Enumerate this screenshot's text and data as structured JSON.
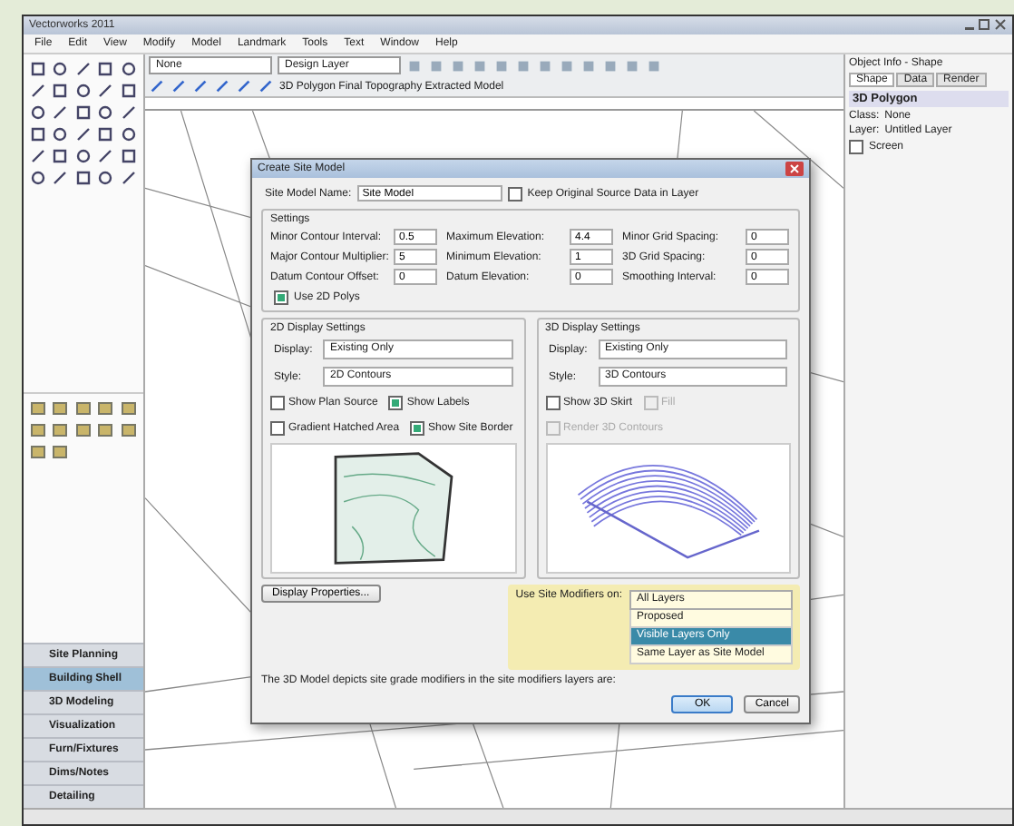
{
  "window": {
    "title": "Vectorworks 2011"
  },
  "menu": [
    "File",
    "Edit",
    "View",
    "Modify",
    "Model",
    "Landmark",
    "Tools",
    "Text",
    "Window",
    "Help"
  ],
  "view_bar": {
    "class": "None",
    "layer": "Design Layer",
    "view_label": "3D Polygon Final Topography Extracted Model"
  },
  "tool_sets": [
    {
      "label": "Site Planning",
      "selected": false
    },
    {
      "label": "Building Shell",
      "selected": true
    },
    {
      "label": "3D Modeling",
      "selected": false
    },
    {
      "label": "Visualization",
      "selected": false
    },
    {
      "label": "Furn/Fixtures",
      "selected": false
    },
    {
      "label": "Dims/Notes",
      "selected": false
    },
    {
      "label": "Detailing",
      "selected": false
    }
  ],
  "object_info": {
    "title": "Object Info - Shape",
    "tabs": [
      {
        "label": "Shape",
        "selected": true
      },
      {
        "label": "Data",
        "selected": false
      },
      {
        "label": "Render",
        "selected": false
      }
    ],
    "object": "3D Polygon",
    "fields": [
      {
        "label": "Class:",
        "value": "None"
      },
      {
        "label": "Layer:",
        "value": "Untitled Layer"
      }
    ],
    "screen": {
      "label": "Screen",
      "checked": false
    }
  },
  "dialog": {
    "title": "Create Site Model",
    "name_label": "Site Model Name:",
    "name_value": "Site Model",
    "keep_source": {
      "label": "Keep Original Source Data in Layer",
      "checked": false
    },
    "settings_title": "Settings",
    "settings": [
      {
        "label": "Minor Contour Interval:",
        "value": "0.5"
      },
      {
        "label": "Maximum Elevation:",
        "value": "4.4"
      },
      {
        "label": "Minor Grid Spacing:",
        "value": "0"
      },
      {
        "label": "Major Contour Multiplier:",
        "value": "5"
      },
      {
        "label": "Minimum Elevation:",
        "value": "1"
      },
      {
        "label": "3D Grid Spacing:",
        "value": "0"
      },
      {
        "label": "Datum Contour Offset:",
        "value": "0"
      },
      {
        "label": "Datum Elevation:",
        "value": "0"
      },
      {
        "label": "Smoothing Interval:",
        "value": "0"
      }
    ],
    "use_polys": {
      "label": "Use 2D Polys",
      "checked": true
    },
    "panels": [
      {
        "title": "2D Display Settings",
        "display_label": "Display:",
        "display": "Existing Only",
        "style_label": "Style:",
        "style": "2D Contours",
        "checks": [
          {
            "label": "Show Plan Source",
            "checked": false,
            "disabled": false
          },
          {
            "label": "Show Labels",
            "checked": true,
            "disabled": false
          },
          {
            "label": "Gradient Hatched Area",
            "checked": false,
            "disabled": false
          },
          {
            "label": "Show Site Border",
            "checked": true,
            "disabled": false
          }
        ],
        "kind": "plan"
      },
      {
        "title": "3D Display Settings",
        "display_label": "Display:",
        "display": "Existing Only",
        "style_label": "Style:",
        "style": "3D Contours",
        "checks": [
          {
            "label": "Show 3D Skirt",
            "checked": false,
            "disabled": false
          },
          {
            "label": "Fill",
            "checked": false,
            "disabled": true
          },
          {
            "label": "Render 3D Contours",
            "checked": false,
            "disabled": true
          }
        ],
        "kind": "mesh"
      }
    ],
    "display_button": "Display Properties...",
    "modifiers_label": "Use Site Modifiers on:",
    "modifiers_value": "All Layers",
    "modifiers_options": [
      {
        "label": "Proposed",
        "selected": false
      },
      {
        "label": "Visible Layers Only",
        "selected": true
      },
      {
        "label": "Same Layer as Site Model",
        "selected": false
      }
    ],
    "note": "The 3D Model depicts site grade modifiers in the site modifiers layers are:",
    "buttons": [
      {
        "label": "OK",
        "kind": "default"
      },
      {
        "label": "Cancel",
        "kind": "normal"
      }
    ]
  }
}
